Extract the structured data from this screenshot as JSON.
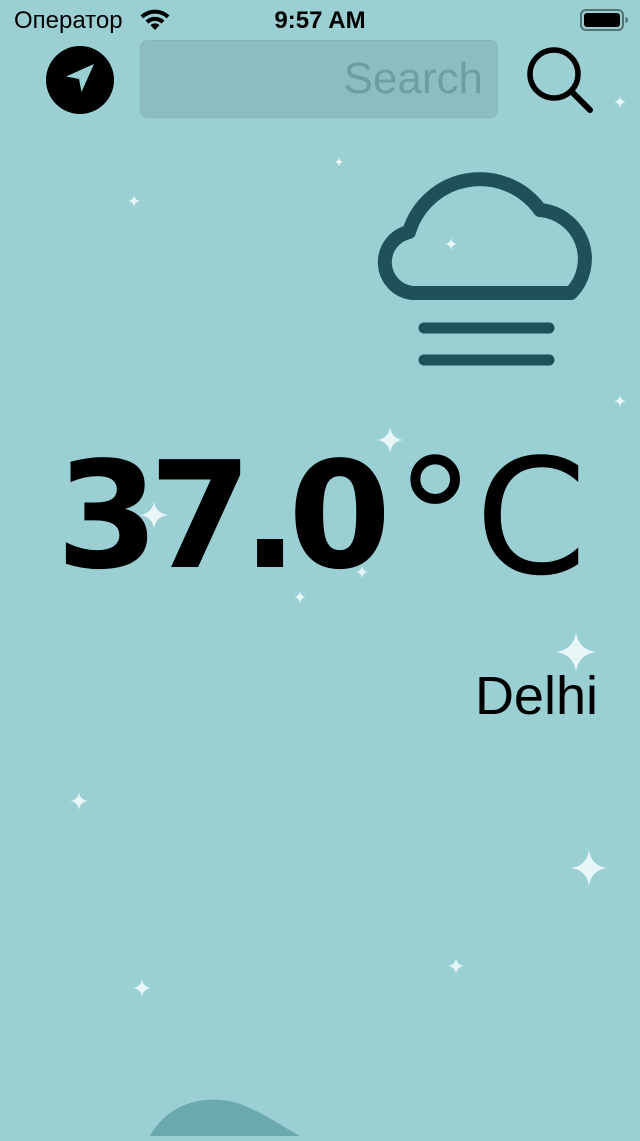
{
  "status_bar": {
    "carrier": "Оператор",
    "time": "9:57 AM"
  },
  "search": {
    "placeholder": "Search",
    "value": ""
  },
  "weather": {
    "condition_icon": "cloud-fog-icon",
    "temperature": "37.0",
    "unit": "°C",
    "city": "Delhi"
  },
  "icons": {
    "location": "location-arrow-icon",
    "search": "magnifier-icon"
  },
  "colors": {
    "background": "#9acfd4",
    "weather_icon": "#1f5159",
    "sparkle": "#e8f6f7"
  }
}
